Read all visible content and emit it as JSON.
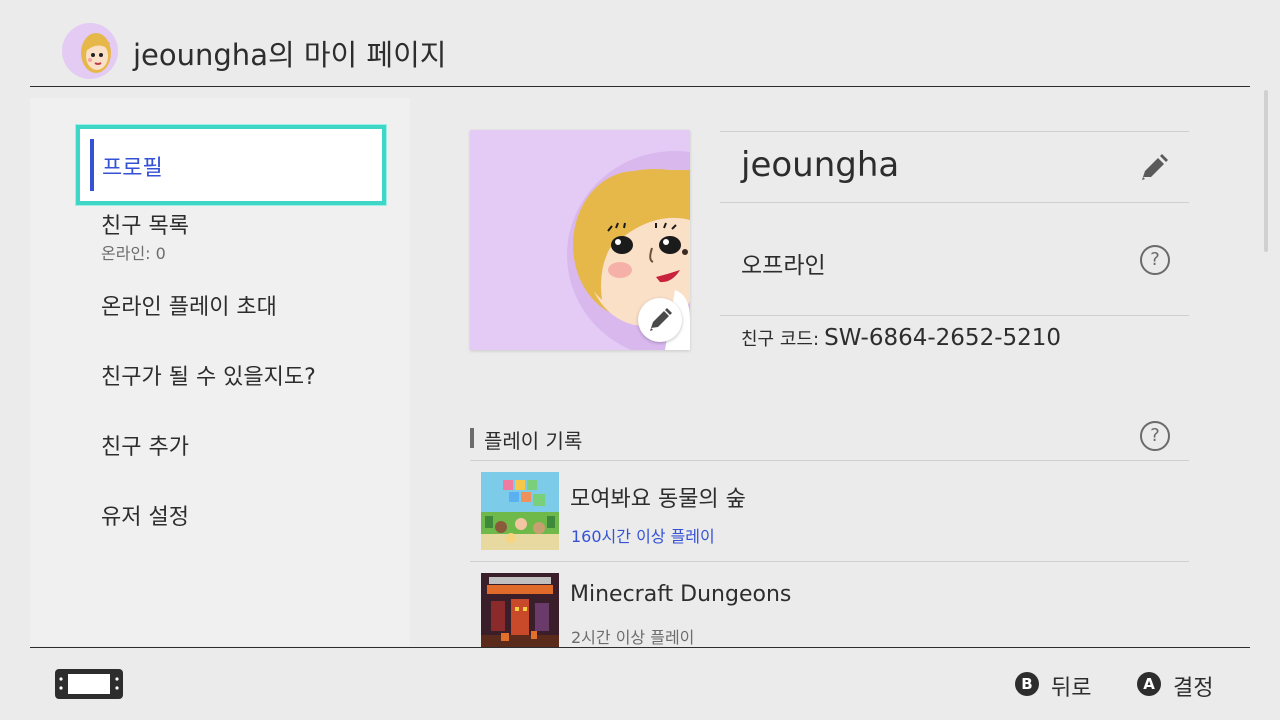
{
  "header": {
    "title": "jeoungha의 마이 페이지",
    "avatar_icon": "mii-avatar-icon"
  },
  "sidebar": {
    "items": [
      {
        "label": "프로필",
        "selected": true
      },
      {
        "label": "친구 목록",
        "sub": "온라인: 0"
      },
      {
        "label": "온라인 플레이 초대"
      },
      {
        "label": "친구가 될 수 있을지도?"
      },
      {
        "label": "친구 추가"
      },
      {
        "label": "유저 설정"
      }
    ]
  },
  "profile": {
    "username": "jeoungha",
    "status": "오프라인",
    "friend_code_label": "친구 코드:",
    "friend_code": "SW-6864-2652-5210",
    "edit_icon": "pencil-icon",
    "help_icon": "question-mark-icon"
  },
  "play_history": {
    "title": "플레이 기록",
    "games": [
      {
        "title": "모여봐요 동물의 숲",
        "time": "160시간 이상 플레이",
        "time_color": "#3552d6"
      },
      {
        "title": "Minecraft Dungeons",
        "time": "2시간 이상 플레이",
        "time_color": "#6d6d6d"
      }
    ]
  },
  "footer": {
    "console_icon": "switch-console-icon",
    "buttons": [
      {
        "key": "B",
        "label": "뒤로"
      },
      {
        "key": "A",
        "label": "결정"
      }
    ]
  },
  "colors": {
    "accent": "#3552d6",
    "focus": "#3ed6c6",
    "avatar_bg": "#e4cbf6"
  }
}
